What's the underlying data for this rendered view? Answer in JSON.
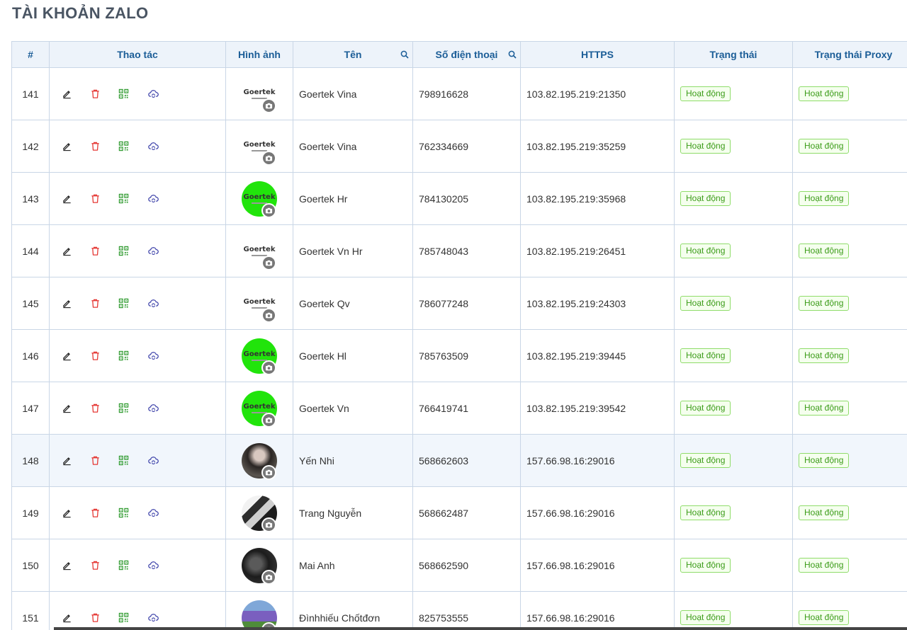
{
  "page": {
    "title": "TÀI KHOẢN ZALO"
  },
  "table": {
    "columns": [
      "#",
      "Thao tác",
      "Hình ảnh",
      "Tên",
      "Số điện thoại",
      "HTTPS",
      "Trạng thái",
      "Trạng thái Proxy"
    ],
    "rows": [
      {
        "id": "141",
        "avatar": "goertek-logo-white",
        "name": "Goertek Vina",
        "phone": "798916628",
        "https": "103.82.195.219:21350",
        "status": "Hoạt động",
        "proxy_status": "Hoạt động"
      },
      {
        "id": "142",
        "avatar": "goertek-logo-white",
        "name": "Goertek Vina",
        "phone": "762334669",
        "https": "103.82.195.219:35259",
        "status": "Hoạt động",
        "proxy_status": "Hoạt động"
      },
      {
        "id": "143",
        "avatar": "goertek-logo-green",
        "name": "Goertek Hr",
        "phone": "784130205",
        "https": "103.82.195.219:35968",
        "status": "Hoạt động",
        "proxy_status": "Hoạt động"
      },
      {
        "id": "144",
        "avatar": "goertek-logo-white",
        "name": "Goertek Vn Hr",
        "phone": "785748043",
        "https": "103.82.195.219:26451",
        "status": "Hoạt động",
        "proxy_status": "Hoạt động"
      },
      {
        "id": "145",
        "avatar": "goertek-logo-white",
        "name": "Goertek Qv",
        "phone": "786077248",
        "https": "103.82.195.219:24303",
        "status": "Hoạt động",
        "proxy_status": "Hoạt động"
      },
      {
        "id": "146",
        "avatar": "goertek-logo-green",
        "name": "Goertek Hl",
        "phone": "785763509",
        "https": "103.82.195.219:39445",
        "status": "Hoạt động",
        "proxy_status": "Hoạt động"
      },
      {
        "id": "147",
        "avatar": "goertek-logo-green",
        "name": "Goertek Vn",
        "phone": "766419741",
        "https": "103.82.195.219:39542",
        "status": "Hoạt động",
        "proxy_status": "Hoạt động"
      },
      {
        "id": "148",
        "avatar": "photo1",
        "name": "Yến Nhi",
        "phone": "568662603",
        "https": "157.66.98.16:29016",
        "status": "Hoạt động",
        "proxy_status": "Hoạt động",
        "highlighted": true
      },
      {
        "id": "149",
        "avatar": "photo2",
        "name": "Trang Nguyễn",
        "phone": "568662487",
        "https": "157.66.98.16:29016",
        "status": "Hoạt động",
        "proxy_status": "Hoạt động"
      },
      {
        "id": "150",
        "avatar": "photo3",
        "name": "Mai Anh",
        "phone": "568662590",
        "https": "157.66.98.16:29016",
        "status": "Hoạt động",
        "proxy_status": "Hoạt động"
      },
      {
        "id": "151",
        "avatar": "photo4",
        "name": "Đìnhhiếu Chốtđơn",
        "phone": "825753555",
        "https": "157.66.98.16:29016",
        "status": "Hoạt động",
        "proxy_status": "Hoạt động"
      }
    ],
    "brand_text": "Goertek"
  },
  "icons": {
    "edit": "pencil-icon",
    "delete": "trash-icon",
    "qr": "qr-code-icon",
    "proxy": "cloud-sync-icon",
    "search": "search-icon",
    "camera": "camera-icon"
  },
  "colors": {
    "header_text": "#1b5d97",
    "header_bg": "#edf3fa",
    "badge_green": "#3b9b18",
    "delete_red": "#e53935",
    "qr_green": "#2e9a2e",
    "proxy_blue": "#3a3fa8"
  }
}
